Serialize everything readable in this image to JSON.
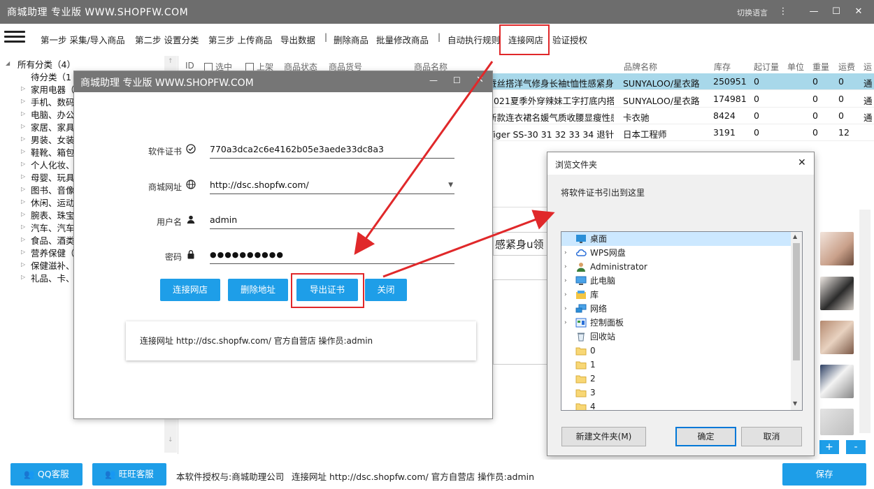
{
  "app": {
    "title": "商城助理 专业版 WWW.SHOPFW.COM",
    "language_label": "切换语言"
  },
  "toolbar": {
    "items": [
      "第一步 采集/导入商品",
      "第二步 设置分类",
      "第三步 上传商品",
      "导出数据",
      "删除商品",
      "批量修改商品",
      "自动执行规则",
      "连接网店",
      "验证授权"
    ]
  },
  "tree": {
    "root": "所有分类（4）",
    "items": [
      "待分类（1",
      "家用电器（",
      "手机、数码",
      "电脑、办公",
      "家居、家具",
      "男装、女装",
      "鞋靴、箱包",
      "个人化妆、",
      "母婴、玩具",
      "图书、音像",
      "休闲、运动",
      "腕表、珠宝",
      "汽车、汽车",
      "食品、酒类",
      "营养保健（",
      "保健滋补、",
      "礼品、卡、"
    ]
  },
  "grid": {
    "headers": [
      "ID",
      "选中",
      "上架",
      "商品状态",
      "商品货号",
      "商品名称",
      "品牌名称",
      "库存",
      "起订量",
      "单位",
      "重量",
      "运费",
      "运"
    ],
    "rows": [
      {
        "name": "蚕丝搭洋气修身长袖t恤性感紧身u领",
        "brand": "SUNYALOO/星衣路",
        "stock": "250951",
        "min": "0",
        "weight": "0",
        "freight": "0",
        "extra": "通"
      },
      {
        "name": "2021夏季外穿辣妹工字打底内搭性感",
        "brand": "SUNYALOO/星衣路",
        "stock": "174981",
        "min": "0",
        "weight": "0",
        "freight": "0",
        "extra": "通"
      },
      {
        "name": "新款连衣裙名媛气质收腰显瘦性感",
        "brand": "卡衣驰",
        "stock": "8424",
        "min": "0",
        "weight": "0",
        "freight": "0",
        "extra": "通"
      },
      {
        "name": "Tiger SS-30 31 32 33 34 退针器",
        "brand": "日本工程师",
        "stock": "3191",
        "min": "0",
        "weight": "0",
        "freight": "12",
        "extra": ""
      }
    ]
  },
  "detail": {
    "name_fragment": "感紧身u领"
  },
  "dialog_connect": {
    "title": "商城助理 专业版 WWW.SHOPFW.COM",
    "license_label": "软件证书",
    "license_value": "770a3dca2c6e4162b05e3aede33dc8a3",
    "url_label": "商城网址",
    "url_value": "http://dsc.shopfw.com/",
    "user_label": "用户名",
    "user_value": "admin",
    "password_label": "密码",
    "password_value": "●●●●●●●●●●",
    "buttons": {
      "connect": "连接网店",
      "delete": "删除地址",
      "export": "导出证书",
      "close": "关闭"
    },
    "status": "连接网址 http://dsc.shopfw.com/ 官方自营店 操作员:admin"
  },
  "dialog_browse": {
    "title": "浏览文件夹",
    "instruction": "将软件证书引出到这里",
    "items": [
      {
        "label": "桌面",
        "icon": "desktop-icon",
        "expander": "",
        "selected": true
      },
      {
        "label": "WPS网盘",
        "icon": "cloud-icon",
        "expander": "›"
      },
      {
        "label": "Administrator",
        "icon": "user-icon",
        "expander": "›"
      },
      {
        "label": "此电脑",
        "icon": "computer-icon",
        "expander": "›"
      },
      {
        "label": "库",
        "icon": "library-icon",
        "expander": "›"
      },
      {
        "label": "网络",
        "icon": "network-icon",
        "expander": "›"
      },
      {
        "label": "控制面板",
        "icon": "control-panel-icon",
        "expander": "›"
      },
      {
        "label": "回收站",
        "icon": "recycle-bin-icon",
        "expander": ""
      },
      {
        "label": "0",
        "icon": "folder-icon",
        "expander": ""
      },
      {
        "label": "1",
        "icon": "folder-icon",
        "expander": ""
      },
      {
        "label": "2",
        "icon": "folder-icon",
        "expander": ""
      },
      {
        "label": "3",
        "icon": "folder-icon",
        "expander": ""
      },
      {
        "label": "4",
        "icon": "folder-icon",
        "expander": ""
      }
    ],
    "buttons": {
      "new_folder": "新建文件夹(M)",
      "ok": "确定",
      "cancel": "取消"
    }
  },
  "side_buttons": {
    "plus": "+",
    "minus": "-"
  },
  "footer": {
    "qq": "QQ客服",
    "wangwang": "旺旺客服",
    "license_text": "本软件授权与:商城助理公司",
    "status": "连接网址 http://dsc.shopfw.com/ 官方自营店 操作员:admin",
    "save": "保存"
  },
  "colors": {
    "accent": "#1e9ee8",
    "titlebar": "#6d6d6d",
    "highlight": "#e0282a",
    "selected_row": "#a8d8ea"
  }
}
